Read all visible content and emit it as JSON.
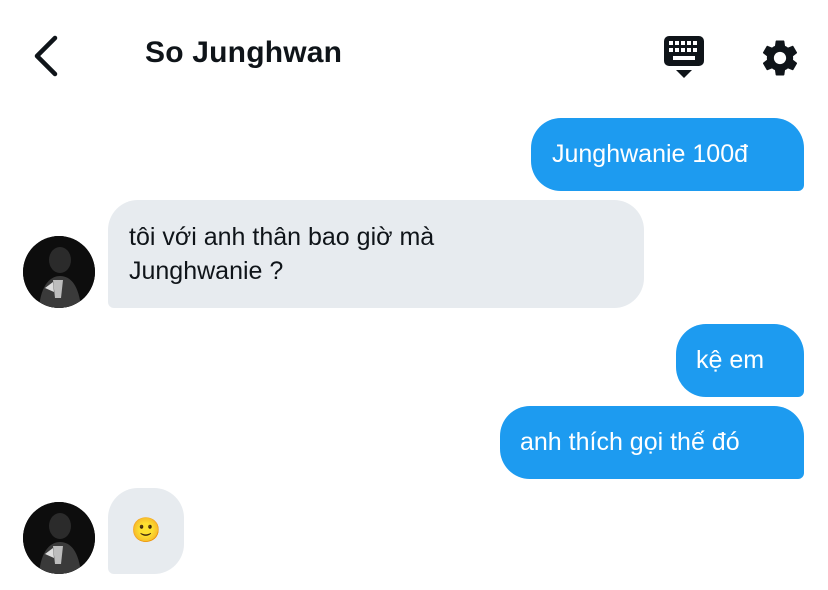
{
  "header": {
    "contact_name": "So Junghwan"
  },
  "icons": {
    "back": "chevron-left-icon",
    "keyboard": "keyboard-icon",
    "settings": "gear-icon"
  },
  "colors": {
    "outgoing_bubble": "#1d9bf0",
    "incoming_bubble": "#e7ebef",
    "text": "#0f1419"
  },
  "messages": [
    {
      "direction": "outgoing",
      "text": "Junghwanie 100đ"
    },
    {
      "direction": "incoming",
      "lines": [
        "tôi với anh thân bao giờ mà",
        "Junghwanie ?"
      ]
    },
    {
      "direction": "outgoing",
      "text": "kệ em"
    },
    {
      "direction": "outgoing",
      "text": "anh thích gọi thế đó"
    },
    {
      "direction": "incoming",
      "text": "🙂"
    }
  ]
}
